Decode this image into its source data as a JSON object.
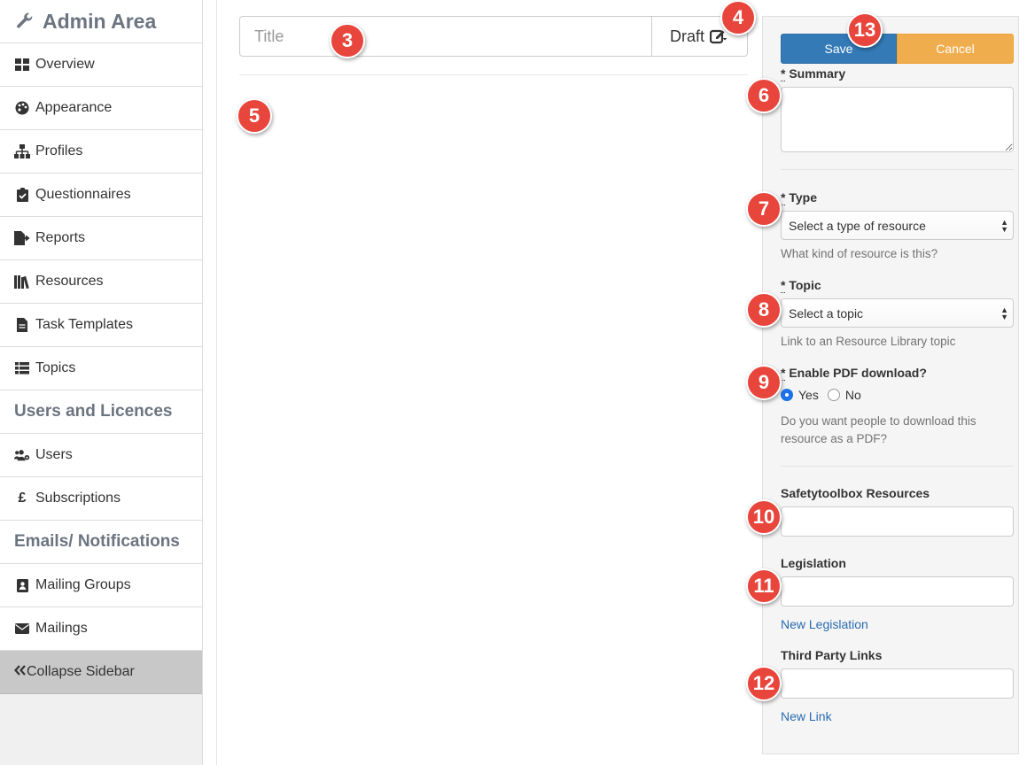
{
  "sidebar": {
    "header": "Admin Area",
    "items": [
      {
        "label": "Overview",
        "icon": "grid-icon"
      },
      {
        "label": "Appearance",
        "icon": "palette-icon"
      },
      {
        "label": "Profiles",
        "icon": "sitemap-icon"
      },
      {
        "label": "Questionnaires",
        "icon": "clipboard-check-icon"
      },
      {
        "label": "Reports",
        "icon": "file-export-icon"
      },
      {
        "label": "Resources",
        "icon": "books-icon"
      },
      {
        "label": "Task Templates",
        "icon": "file-icon"
      },
      {
        "label": "Topics",
        "icon": "list-icon"
      }
    ],
    "section_users": "Users and Licences",
    "users_items": [
      {
        "label": "Users",
        "icon": "users-cog-icon"
      },
      {
        "label": "Subscriptions",
        "icon": "pound-icon"
      }
    ],
    "section_emails": "Emails/ Notifications",
    "email_items": [
      {
        "label": "Mailing Groups",
        "icon": "address-book-icon"
      },
      {
        "label": "Mailings",
        "icon": "envelope-icon"
      }
    ],
    "collapse": "Collapse Sidebar"
  },
  "editor": {
    "title_placeholder": "Title",
    "status": "Draft"
  },
  "panel": {
    "save": "Save",
    "cancel": "Cancel",
    "summary_label": "Summary",
    "type_label": "Type",
    "type_select": "Select a type of resource",
    "type_help": "What kind of resource is this?",
    "topic_label": "Topic",
    "topic_select": "Select a topic",
    "topic_help": "Link to an Resource Library topic",
    "pdf_label": "Enable PDF download?",
    "pdf_yes": "Yes",
    "pdf_no": "No",
    "pdf_help": "Do you want people to download this resource as a PDF?",
    "safety_label": "Safetytoolbox Resources",
    "legislation_label": "Legislation",
    "new_legislation": "New Legislation",
    "third_party_label": "Third Party Links",
    "new_link": "New Link",
    "required_mark": "*"
  },
  "badges": [
    "3",
    "4",
    "5",
    "6",
    "7",
    "8",
    "9",
    "10",
    "11",
    "12",
    "13"
  ],
  "colors": {
    "save": "#337ab7",
    "cancel": "#f0ad4e",
    "badge": "#e8453c",
    "link": "#2a6bb0"
  }
}
